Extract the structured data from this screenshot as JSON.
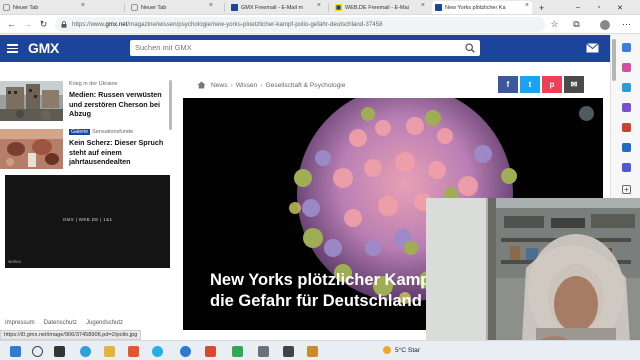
{
  "browser": {
    "tabs": [
      {
        "title": "Neuer Tab",
        "active": false
      },
      {
        "title": "Neuer Tab",
        "active": false
      },
      {
        "title": "GMX Freemail - E-Mail m",
        "active": false
      },
      {
        "title": "WEB.DE Freemail - E-Mai",
        "active": false
      },
      {
        "title": "New Yorks plötzlicher Ka",
        "active": true
      }
    ],
    "new_tab_label": "+",
    "url_prefix": "https://www.",
    "url_domain": "gmx.net",
    "url_path": "/magazine/wissen/psychologie/new-yorks-ploetzlicher-kampf-polio-gefahr-deutschland-37458"
  },
  "header": {
    "logo": "GMX",
    "search_placeholder": "Suchen mit GMX"
  },
  "sidebar": {
    "items": [
      {
        "kicker": "Krieg in der Ukraine",
        "badge": "",
        "title": "Medien: Russen verwüsten und zerstören Cherson bei Abzug"
      },
      {
        "kicker": "Sensationsfunde",
        "badge": "Galerie",
        "title": "Kein Scherz: Dieser Spruch steht auf einem jahrtausendealten"
      }
    ],
    "video_logos": "GMX | WEB.DE | 1&1",
    "video_tag": "WORLD",
    "footer_links": [
      "Impressum",
      "Datenschutz",
      "Jugendschutz"
    ]
  },
  "article": {
    "breadcrumb": [
      "News",
      "Wissen",
      "Gesellschaft & Psychologie"
    ],
    "share": [
      {
        "name": "facebook",
        "label": "f",
        "color": "#3b5998"
      },
      {
        "name": "twitter",
        "label": "t",
        "color": "#1da1f2"
      },
      {
        "name": "pocket",
        "label": "p",
        "color": "#ef3f56"
      },
      {
        "name": "email",
        "label": "✉",
        "color": "#4a4a4a"
      }
    ],
    "headline_line1": "New Yorks plötzlicher Kamp",
    "headline_line2": "die Gefahr für Deutschland"
  },
  "status_url": "https://i0.gmx.net/image/906/37458906,pd=2/polio.jpg",
  "taskbar": {
    "weather": "5°C",
    "weather_suffix": "Star"
  },
  "colors": {
    "gmx_blue": "#1c449b",
    "taskbar": "#e8eef4"
  }
}
